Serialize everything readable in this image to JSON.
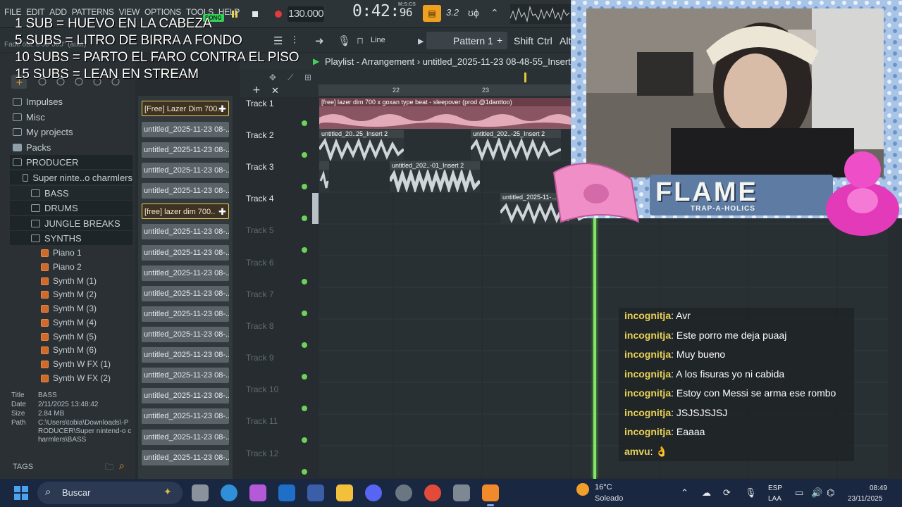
{
  "menu": [
    "FILE",
    "EDIT",
    "ADD",
    "PATTERNS",
    "VIEW",
    "OPTIONS",
    "TOOLS",
    "HELP"
  ],
  "hint": "Fade out:  0'00\"000\" (auto)",
  "song_badge": "SONG",
  "transport": {
    "tempo": "130.000",
    "time_main": "0:42:",
    "time_small": "96",
    "time_label": "M:S:CS",
    "time_sig": "3.2"
  },
  "toolbar2": {
    "snap": "Line",
    "pattern": "Pattern 1",
    "pattern_plus": "+",
    "shift": "Shift",
    "ctrl": "Ctrl",
    "alt": "Alt"
  },
  "overlay_rules": [
    "1 SUB = HUEVO EN LA CABEZA",
    "5 SUBS = LITRO DE BIRRA A FONDO",
    "10 SUBS = PARTO EL FARO CONTRA EL PISO",
    "15 SUBS = LEAN EN STREAM"
  ],
  "browser": {
    "items": [
      {
        "label": "Impulses"
      },
      {
        "label": "Misc"
      },
      {
        "label": "My projects"
      },
      {
        "label": "Packs"
      },
      {
        "label": "PRODUCER"
      },
      {
        "label": "Super ninte..o charmlers"
      },
      {
        "label": "BASS"
      },
      {
        "label": "DRUMS"
      },
      {
        "label": "JUNGLE BREAKS"
      },
      {
        "label": "SYNTHS"
      },
      {
        "label": "Piano 1"
      },
      {
        "label": "Piano 2"
      },
      {
        "label": "Synth M (1)"
      },
      {
        "label": "Synth M (2)"
      },
      {
        "label": "Synth M (3)"
      },
      {
        "label": "Synth M (4)"
      },
      {
        "label": "Synth M (5)"
      },
      {
        "label": "Synth M (6)"
      },
      {
        "label": "Synth W FX (1)"
      },
      {
        "label": "Synth W FX (2)"
      }
    ],
    "info": {
      "title_key": "Title",
      "title_val": "BASS",
      "date_key": "Date",
      "date_val": "2/11/2025 13:48:42",
      "size_key": "Size",
      "size_val": "2.84 MB",
      "path_key": "Path",
      "path_val": "C:\\Users\\tobia\\Downloads\\-PRODUCER\\Super nintend-o charmlers\\BASS"
    },
    "tags": "TAGS"
  },
  "picker": [
    "[Free] Lazer Dim 700..",
    "untitled_2025-11-23 08-..",
    "untitled_2025-11-23 08-..",
    "untitled_2025-11-23 08-..",
    "untitled_2025-11-23 08-..",
    "[free] lazer dim 700..",
    "untitled_2025-11-23 08-..",
    "untitled_2025-11-23 08-..",
    "untitled_2025-11-23 08-..",
    "untitled_2025-11-23 08-..",
    "untitled_2025-11-23 08-..",
    "untitled_2025-11-23 08-..",
    "untitled_2025-11-23 08-..",
    "untitled_2025-11-23 08-..",
    "untitled_2025-11-23 08-..",
    "untitled_2025-11-23 08-..",
    "untitled_2025-11-23 08-..",
    "untitled_2025-11-23 08-.."
  ],
  "playlist": {
    "title": "Playlist - Arrangement  ›  untitled_2025-11-23 08-48-55_Insert",
    "ruler": [
      "22",
      "23"
    ],
    "tracks": [
      "Track 1",
      "Track 2",
      "Track 3",
      "Track 4",
      "Track 5",
      "Track 6",
      "Track 7",
      "Track 8",
      "Track 9",
      "Track 10",
      "Track 11",
      "Track 12"
    ],
    "clips": [
      {
        "label": "[free] lazer dim 700 x goxan type beat - sleepover (prod @1danttoo)"
      },
      {
        "label": "untitled_20..25_Insert 2"
      },
      {
        "label": "untitled_202..-25_Insert 2"
      },
      {
        "label": ""
      },
      {
        "label": "untitled_202..-01_Insert 2"
      },
      {
        "label": "untitled_2025-11-..."
      }
    ]
  },
  "stream": {
    "logo": "FLAME",
    "logo_sub": "TRAP-A-HOLICS"
  },
  "chat": [
    {
      "user": "incognitja",
      "text": "Avr"
    },
    {
      "user": "incognitja",
      "text": "Este porro me deja puaaj"
    },
    {
      "user": "incognitja",
      "text": "Muy bueno"
    },
    {
      "user": "incognitja",
      "text": "A los fisuras yo ni cabida"
    },
    {
      "user": "incognitja",
      "text": "Estoy con Messi se arma ese rombo"
    },
    {
      "user": "incognitja",
      "text": "JSJSJSJSJ"
    },
    {
      "user": "incognitja",
      "text": "Eaaaa"
    },
    {
      "user": "amvu",
      "text": "👌"
    }
  ],
  "taskbar": {
    "search": "Buscar",
    "weather_temp": "16°C",
    "weather_desc": "Soleado",
    "lang1": "ESP",
    "lang2": "LAA",
    "time": "08:49",
    "date": "23/11/2025"
  },
  "colors": {
    "accent": "#f0a020",
    "clip_pink": "#8a5562",
    "clip_gray": "#2f3639",
    "green_line": "#86e36a",
    "chat_user": "#e8d257"
  }
}
